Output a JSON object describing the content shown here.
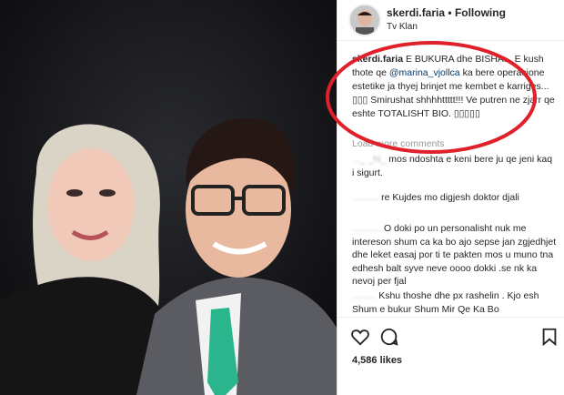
{
  "header": {
    "username": "skerdi.faria",
    "separator": "•",
    "follow_label": "Following",
    "location": "Tv Klan"
  },
  "caption": {
    "author": "skerdi.faria",
    "text_1": "E BUKURA dhe BISHA... E kush thote qe",
    "mention": "@marina_vjollca",
    "text_2": "ka bere operacione estetike ja thyej brinjet me kembet e karriges... ▯▯▯ Smirushat shhhhttttt!!! Ve putren ne zjarr qe eshte TOTALISHT BIO. ▯▯▯▯▯"
  },
  "load_more": "Load more comments",
  "comments": [
    {
      "user": "..._ _hi_",
      "text": "mos ndoshta e keni bere ju qe jeni kaq i sigurt."
    },
    {
      "user": "..........",
      "text": "re Kujdes mo digjesh doktor djali"
    },
    {
      "user": "...........",
      "text": "O doki po un personalisht nuk me intereson shum ca ka bo ajo sepse jan zgjedhjet dhe leket easaj por ti te pakten mos u muno tna edhesh balt syve neve oooo dokki .se nk ka nevoj per fjal"
    },
    {
      "user": ".........",
      "text": "Kshu thoshe dhe px rashelin . Kjo esh Shum e bukur Shum Mir Qe Ka Bo"
    }
  ],
  "likes": "4,586 likes",
  "icons": {
    "like": "heart-icon",
    "comment": "comment-icon",
    "save": "bookmark-icon"
  },
  "colors": {
    "annotation": "#e0202a",
    "mention": "#00376b",
    "tie": "#2bb58c"
  }
}
